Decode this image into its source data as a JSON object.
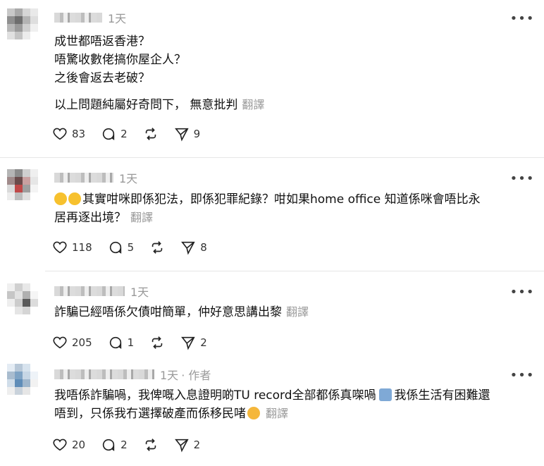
{
  "posts": [
    {
      "time": "1天",
      "lines": [
        "成世都唔返香港？",
        "唔驚收數佬搞你屋企人？",
        "之後會返去老破？"
      ],
      "text2": "以上問題純屬好奇問下， 無意批判",
      "translate": "翻譯",
      "likes": "83",
      "comments": "2",
      "shares": "9"
    },
    {
      "time": "1天",
      "emojis": [
        "😂",
        "😂"
      ],
      "text_line1": "其實咁咪即係犯法，即係犯罪紀錄？咁如果home office 知道係咪會唔比永",
      "text_line2": "居再逐出境？",
      "translate": "翻譯",
      "likes": "118",
      "comments": "5",
      "shares": "8"
    },
    {
      "time": "1天",
      "text": "詐騙已經唔係欠債咁簡單，仲好意思講出黎",
      "translate": "翻譯",
      "likes": "205",
      "comments": "1",
      "shares": "2"
    },
    {
      "time": "1天",
      "author_tag": "· 作者",
      "text_line1": "我唔係詐騙喎，我俾嘅入息證明啲TU record全部都係真㗎喎",
      "emoji_shrug": "🤷‍♂️",
      "text_line1b": "我係生活有困難還",
      "text_line2": "唔到，只係我冇選擇破產而係移民啫",
      "emoji_end": "🥴",
      "translate": "翻譯",
      "likes": "20",
      "comments": "2",
      "shares": "2"
    }
  ],
  "icons": {
    "like": "heart-icon",
    "comment": "comment-icon",
    "repost": "repost-icon",
    "share": "share-icon",
    "more": "more-icon"
  }
}
